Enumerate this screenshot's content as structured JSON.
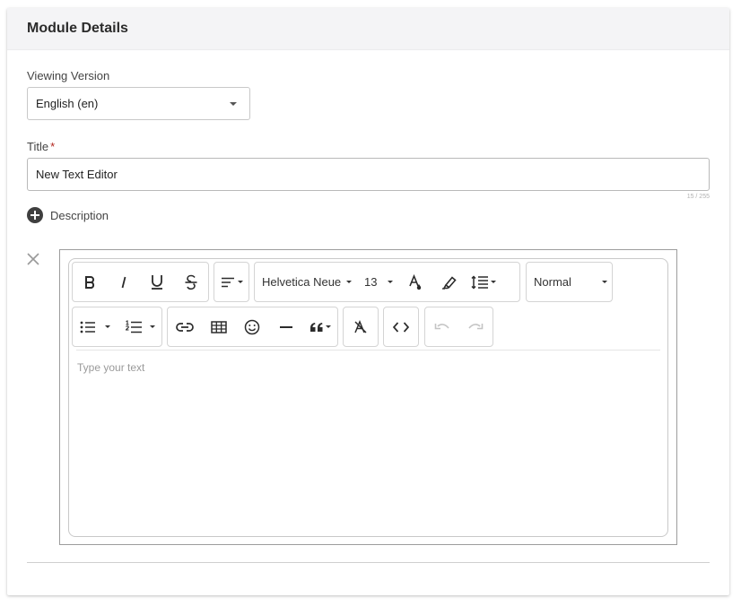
{
  "card": {
    "title": "Module Details"
  },
  "version": {
    "label": "Viewing Version",
    "selected": "English (en)"
  },
  "title_field": {
    "label": "Title",
    "required_mark": "*",
    "value": "New Text Editor",
    "counter": "15 / 255"
  },
  "description": {
    "label": "Description"
  },
  "editor": {
    "font_family": "Helvetica Neue",
    "font_size": "13",
    "block_style": "Normal",
    "placeholder": "Type your text"
  },
  "icons": {
    "close": "close-icon",
    "add": "plus-circle-icon",
    "bold": "bold-icon",
    "italic": "italic-icon",
    "underline": "underline-icon",
    "strike": "strikethrough-icon"
  }
}
